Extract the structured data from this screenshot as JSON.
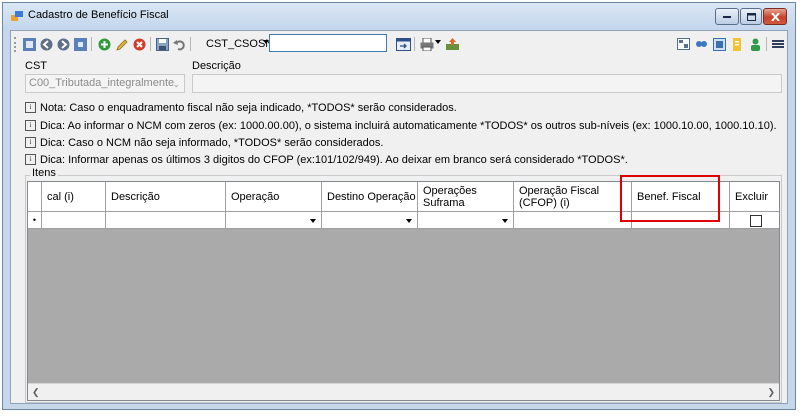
{
  "window": {
    "title": "Cadastro de Benefício Fiscal"
  },
  "toolbar": {
    "cst_label": "CST_CSOSN",
    "cst_value": ""
  },
  "form": {
    "cst_label": "CST",
    "cst_value": "C00_Tributada_integralmente",
    "descricao_label": "Descrição",
    "descricao_value": ""
  },
  "notes": [
    "Nota: Caso o enquadramento fiscal não seja indicado, *TODOS* serão considerados.",
    "Dica: Ao informar o NCM com zeros (ex: 1000.00.00), o sistema incluirá automaticamente *TODOS* os outros sub-níveis (ex: 1000.10.00, 1000.10.10).",
    "Dica: Caso o NCM não seja informado, *TODOS* serão considerados.",
    "Dica: Informar apenas os últimos 3 digitos do CFOP (ex:101/102/949). Ao deixar em branco será considerado *TODOS*."
  ],
  "items": {
    "title": "Itens",
    "columns": [
      "cal (i)",
      "Descrição",
      "Operação",
      "Destino Operação",
      "Operações Suframa",
      "Operação Fiscal (CFOP) (i)",
      "Benef. Fiscal",
      "Excluir"
    ],
    "new_row_marker": "•"
  },
  "colors": {
    "highlight": "#e00000",
    "grid_background": "#aaaaaa"
  }
}
